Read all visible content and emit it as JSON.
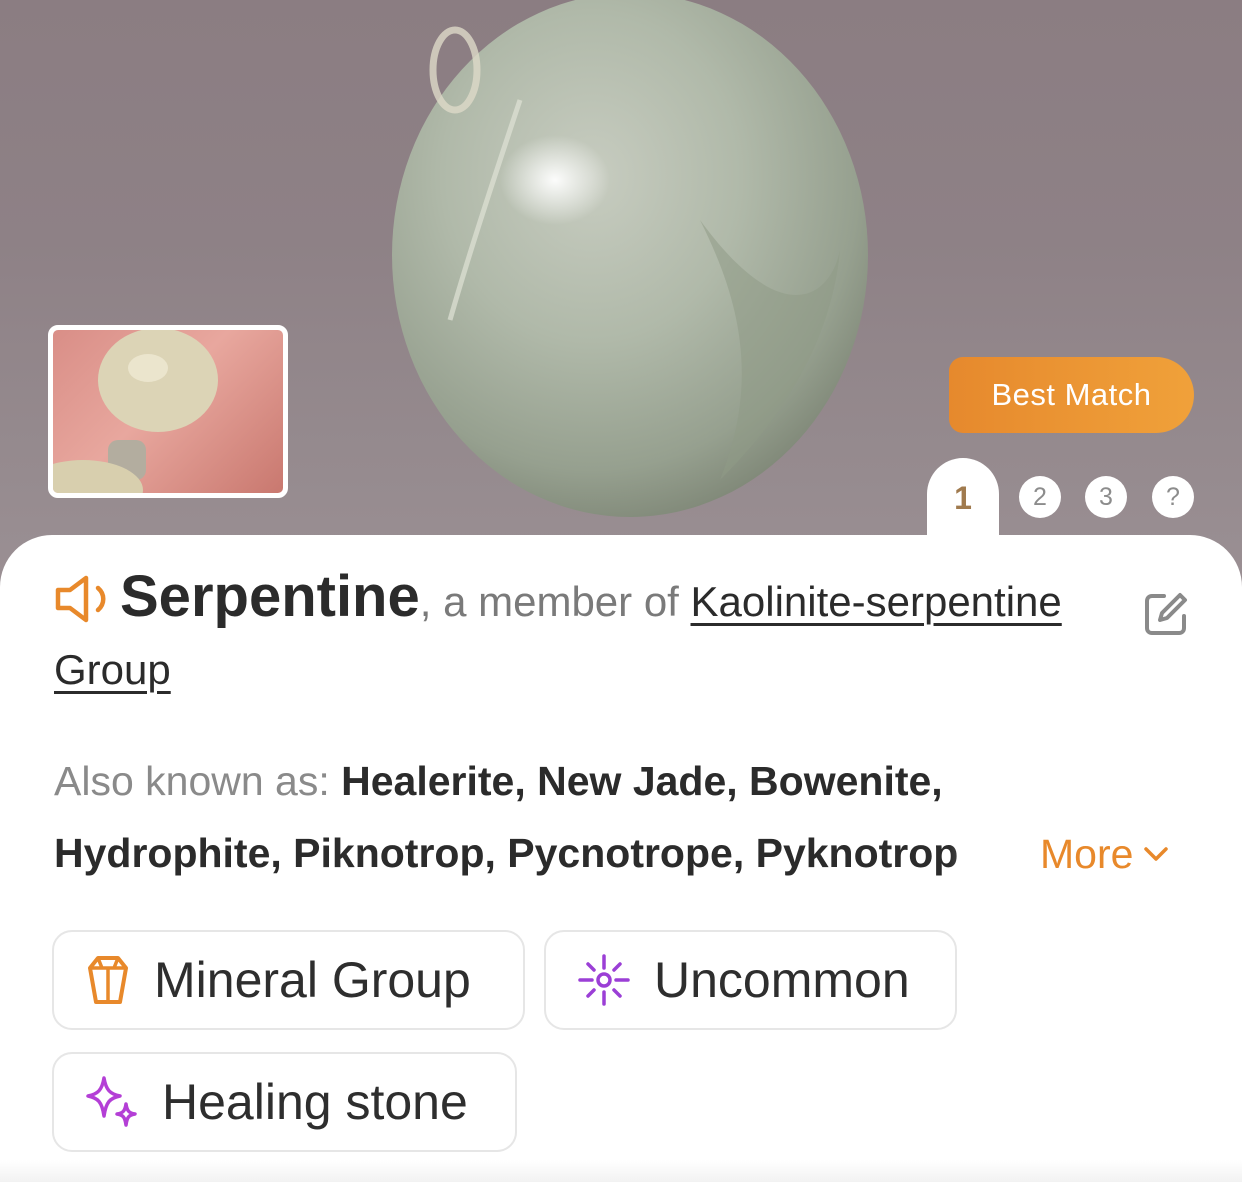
{
  "hero": {
    "best_match_label": "Best Match",
    "tabs": [
      {
        "label": "1",
        "active": true
      },
      {
        "label": "2",
        "active": false
      },
      {
        "label": "3",
        "active": false
      },
      {
        "label": "?",
        "active": false
      }
    ]
  },
  "result": {
    "name": "Serpentine",
    "member_prefix": ", a member of ",
    "group": "Kaolinite-serpentine Group",
    "aka_label": "Also known as: ",
    "aka_line1": "Healerite, New Jade, Bowenite,",
    "aka_line2": "Hydrophite, Piknotrop, Pycnotrope, Pyknotrop",
    "more_label": "More"
  },
  "chips": [
    {
      "label": "Mineral Group",
      "icon": "crystal-icon",
      "color": "#e8892b"
    },
    {
      "label": "Uncommon",
      "icon": "sparkle-burst-icon",
      "color": "#9b3fd6"
    },
    {
      "label": "Healing stone",
      "icon": "sparkles-icon",
      "color": "#b43fd6"
    }
  ],
  "colors": {
    "accent": "#e8892b",
    "text_dark": "#2b2b2b",
    "text_muted": "#8a8a8a"
  }
}
